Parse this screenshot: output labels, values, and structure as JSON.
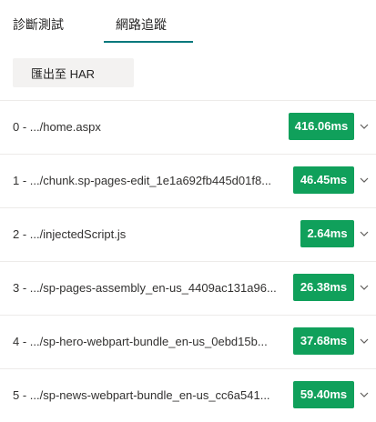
{
  "tabs": [
    {
      "label": "診斷測試",
      "selected": false
    },
    {
      "label": "網路追蹤",
      "selected": true
    }
  ],
  "toolbar": {
    "export_label": "匯出至 HAR"
  },
  "colors": {
    "accent": "#03787c",
    "badge": "#13a10e",
    "badge_dark": "#10a05b"
  },
  "requests": [
    {
      "label": "0 - .../home.aspx",
      "duration": "416.06ms"
    },
    {
      "label": "1 - .../chunk.sp-pages-edit_1e1a692fb445d01f8...",
      "duration": "46.45ms"
    },
    {
      "label": "2 - .../injectedScript.js",
      "duration": "2.64ms"
    },
    {
      "label": "3 - .../sp-pages-assembly_en-us_4409ac131a96...",
      "duration": "26.38ms"
    },
    {
      "label": "4 - .../sp-hero-webpart-bundle_en-us_0ebd15b...",
      "duration": "37.68ms"
    },
    {
      "label": "5 - .../sp-news-webpart-bundle_en-us_cc6a541...",
      "duration": "59.40ms"
    }
  ]
}
